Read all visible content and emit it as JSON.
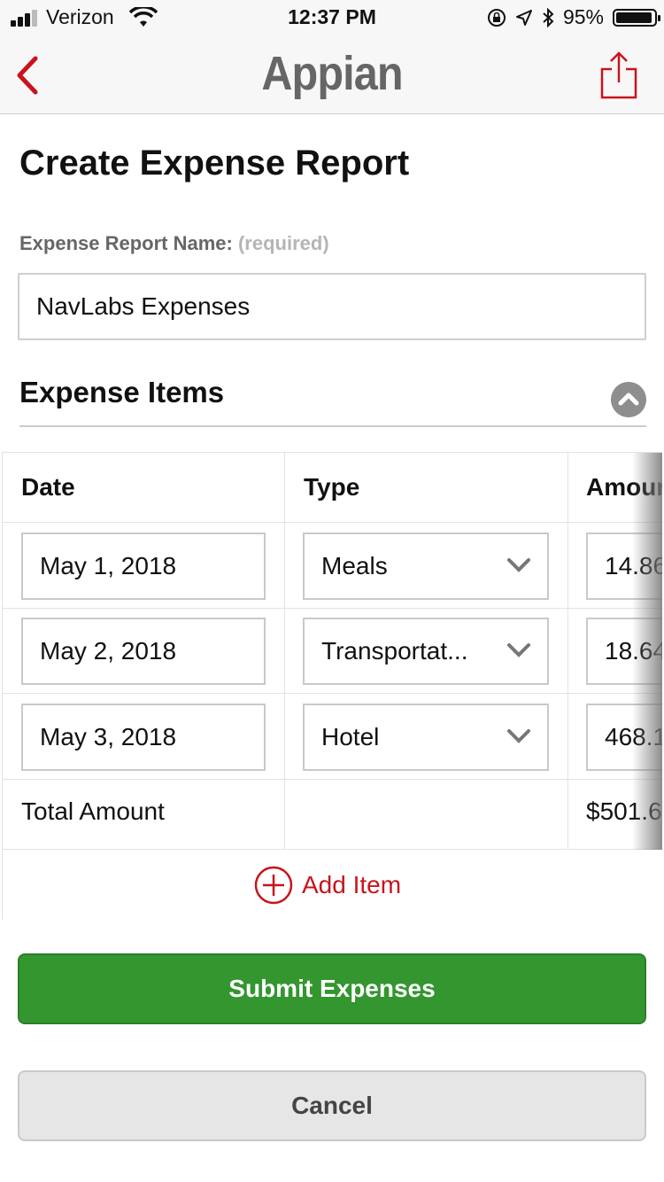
{
  "status_bar": {
    "carrier": "Verizon",
    "time": "12:37 PM",
    "battery_percent": "95%",
    "battery_level": 0.95
  },
  "nav": {
    "logo_text": "Appian",
    "accent_color": "#c8141c"
  },
  "form": {
    "title": "Create Expense Report",
    "name_label": "Expense Report Name:",
    "name_required": "(required)",
    "name_value": "NavLabs Expenses"
  },
  "expense_items": {
    "section_title": "Expense Items",
    "columns": [
      "Date",
      "Type",
      "Amour"
    ],
    "rows": [
      {
        "date": "May 1, 2018",
        "type": "Meals",
        "amount": "14.86"
      },
      {
        "date": "May 2, 2018",
        "type": "Transportat...",
        "amount": "18.64"
      },
      {
        "date": "May 3, 2018",
        "type": "Hotel",
        "amount": "468.1"
      }
    ],
    "total_label": "Total Amount",
    "total_value": "$501.6",
    "add_item_label": "Add Item"
  },
  "actions": {
    "submit_label": "Submit Expenses",
    "submit_color": "#33962f",
    "cancel_label": "Cancel"
  }
}
